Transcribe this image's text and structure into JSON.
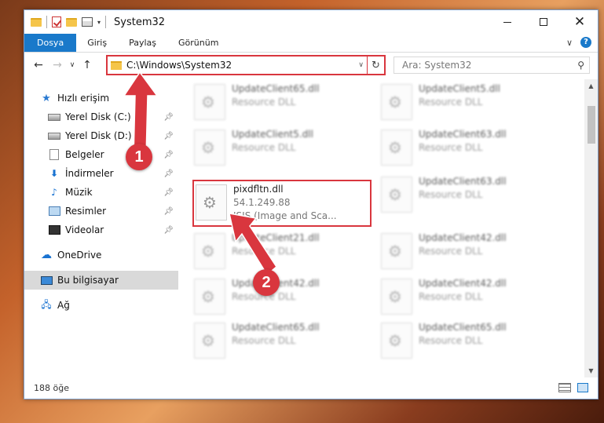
{
  "window": {
    "title": "System32"
  },
  "ribbon": {
    "tabs": [
      "Dosya",
      "Giriş",
      "Paylaş",
      "Görünüm"
    ]
  },
  "address": {
    "path": "C:\\Windows\\System32"
  },
  "search": {
    "placeholder": "Ara: System32"
  },
  "nav": {
    "items": [
      {
        "label": "Hızlı erişim",
        "icon": "star-icon"
      },
      {
        "label": "Yerel Disk (C:)",
        "icon": "disk-icon",
        "pinned": true
      },
      {
        "label": "Yerel Disk (D:)",
        "icon": "disk-icon",
        "pinned": true
      },
      {
        "label": "Belgeler",
        "icon": "document-icon",
        "pinned": true
      },
      {
        "label": "İndirmeler",
        "icon": "download-icon",
        "pinned": true
      },
      {
        "label": "Müzik",
        "icon": "music-icon",
        "pinned": true
      },
      {
        "label": "Resimler",
        "icon": "pictures-icon",
        "pinned": true
      },
      {
        "label": "Videolar",
        "icon": "video-icon",
        "pinned": true
      },
      {
        "label": "OneDrive",
        "icon": "cloud-icon"
      },
      {
        "label": "Bu bilgisayar",
        "icon": "computer-icon",
        "selected": true
      },
      {
        "label": "Ağ",
        "icon": "network-icon"
      }
    ]
  },
  "files": [
    {
      "name": "UpdateClient65.dll",
      "sub": "Resource DLL"
    },
    {
      "name": "UpdateClient5.dll",
      "sub": "Resource DLL"
    },
    {
      "name": "UpdateClient5.dll",
      "sub": "Resource DLL"
    },
    {
      "name": "UpdateClient63.dll",
      "sub": "Resource DLL"
    },
    {
      "name": "pixdfltn.dll",
      "version": "54.1.249.88",
      "sub": "ISIS (Image and Sca...",
      "highlighted": true
    },
    {
      "name": "UpdateClient63.dll",
      "sub": "Resource DLL"
    },
    {
      "name": "UpdateClient21.dll",
      "sub": "Resource DLL"
    },
    {
      "name": "UpdateClient42.dll",
      "sub": "Resource DLL"
    },
    {
      "name": "UpdateClient42.dll",
      "sub": "Resource DLL"
    },
    {
      "name": "UpdateClient42.dll",
      "sub": "Resource DLL"
    },
    {
      "name": "UpdateClient65.dll",
      "sub": "Resource DLL"
    },
    {
      "name": "UpdateClient65.dll",
      "sub": "Resource DLL"
    }
  ],
  "status": {
    "count": "188 öğe"
  },
  "annotations": {
    "step1": "1",
    "step2": "2",
    "color": "#d9363e"
  }
}
